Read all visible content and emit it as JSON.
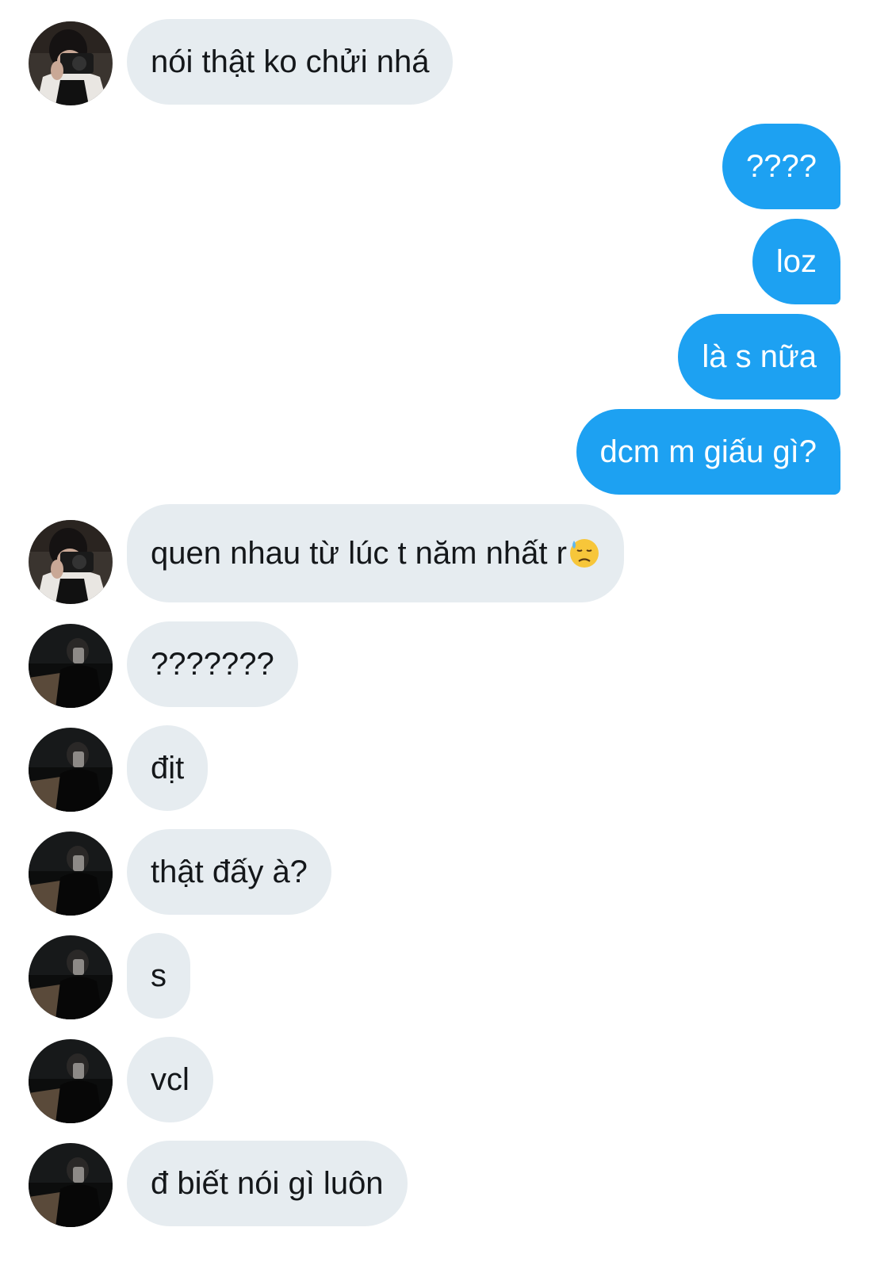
{
  "conversation": {
    "messages": [
      {
        "side": "in",
        "text": "nói thật ko chửi nhá",
        "avatar": "camera-avatar"
      },
      {
        "side": "out",
        "text": "????"
      },
      {
        "side": "out",
        "text": "loz"
      },
      {
        "side": "out",
        "text": "là s nữa"
      },
      {
        "side": "out",
        "text": "dcm m giấu gì?"
      },
      {
        "side": "in",
        "text": "quen nhau từ lúc t năm nhất r",
        "emoji": "downcast-sweat-face-emoji",
        "avatar": "camera-avatar"
      },
      {
        "side": "in",
        "text": "???????",
        "avatar": "dark-avatar"
      },
      {
        "side": "in",
        "text": "địt",
        "avatar": "dark-avatar"
      },
      {
        "side": "in",
        "text": "thật đấy à?",
        "avatar": "dark-avatar"
      },
      {
        "side": "in",
        "text": "s",
        "avatar": "dark-avatar"
      },
      {
        "side": "in",
        "text": "vcl",
        "avatar": "dark-avatar"
      },
      {
        "side": "in",
        "text": "đ biết nói gì luôn",
        "avatar": "dark-avatar"
      }
    ]
  },
  "colors": {
    "incoming_bubble": "#e6ecf0",
    "outgoing_bubble": "#1da1f2",
    "incoming_text": "#14171a",
    "outgoing_text": "#ffffff"
  }
}
